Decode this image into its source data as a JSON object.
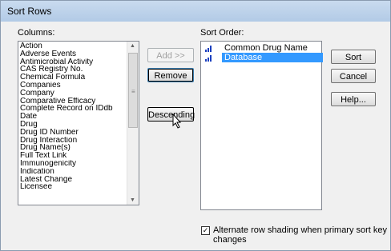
{
  "dialog": {
    "title": "Sort Rows",
    "columns_label": "Columns:",
    "sort_order_label": "Sort Order:",
    "columns": [
      "Action",
      "Adverse Events",
      "Antimicrobial Activity",
      "CAS Registry No.",
      "Chemical Formula",
      "Companies",
      "Company",
      "Comparative Efficacy",
      "Complete Record on IDdb",
      "Date",
      "Drug",
      "Drug ID Number",
      "Drug Interaction",
      "Drug Name(s)",
      "Full Text Link",
      "Immunogenicity",
      "Indication",
      "Latest Change",
      "Licensee"
    ],
    "sort_order": [
      {
        "label": "Common Drug Name",
        "selected": false,
        "icon": "ascending-sort-icon"
      },
      {
        "label": "Database",
        "selected": true,
        "icon": "ascending-sort-icon"
      }
    ],
    "buttons": {
      "add": "Add >>",
      "remove": "Remove",
      "descending": "Descending",
      "sort": "Sort",
      "cancel": "Cancel",
      "help": "Help..."
    },
    "checkbox": {
      "label": "Alternate row shading when primary sort key changes",
      "checked": true,
      "mark": "✓"
    },
    "colors": {
      "selection": "#3399ff",
      "icon": "#1a3fbf"
    }
  }
}
